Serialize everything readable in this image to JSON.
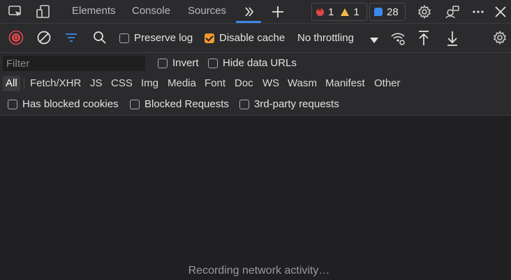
{
  "tabbar": {
    "tabs": [
      {
        "label": "Elements"
      },
      {
        "label": "Console"
      },
      {
        "label": "Sources"
      }
    ],
    "more_tabs_icon": "double-chevron-right-icon",
    "add_tab_icon": "plus-icon",
    "errors_count": "1",
    "warnings_count": "1",
    "issues_count": "28"
  },
  "toolbar": {
    "preserve_log_label": "Preserve log",
    "preserve_log_checked": false,
    "disable_cache_label": "Disable cache",
    "disable_cache_checked": true,
    "throttling_value": "No throttling"
  },
  "filter": {
    "placeholder": "Filter",
    "invert_label": "Invert",
    "hide_data_urls_label": "Hide data URLs"
  },
  "types": [
    "All",
    "Fetch/XHR",
    "JS",
    "CSS",
    "Img",
    "Media",
    "Font",
    "Doc",
    "WS",
    "Wasm",
    "Manifest",
    "Other"
  ],
  "extra_filters": {
    "blocked_cookies_label": "Has blocked cookies",
    "blocked_requests_label": "Blocked Requests",
    "third_party_label": "3rd-party requests"
  },
  "status": {
    "recording_text": "Recording network activity…"
  },
  "colors": {
    "accent": "#3d8aee",
    "record_red": "#e0474d",
    "checkbox_orange": "#f29b2c",
    "warning_yellow": "#f2b84b"
  }
}
